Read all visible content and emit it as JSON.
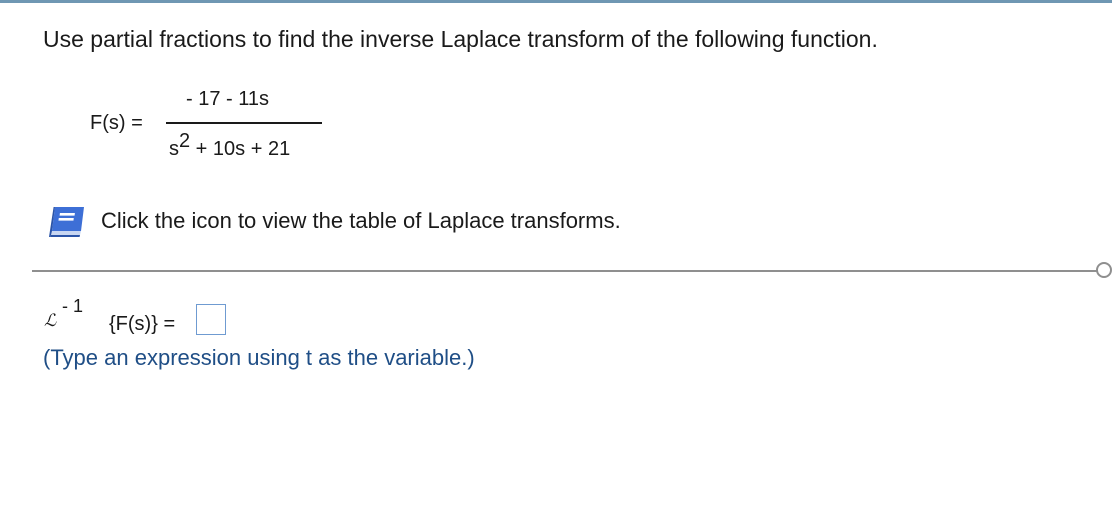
{
  "question": {
    "prompt": "Use partial fractions to find the inverse Laplace transform of the following function."
  },
  "function": {
    "label": "F(s) =",
    "numerator": "- 17 - 11s",
    "denominator_base": "s",
    "denominator_exponent": "2",
    "denominator_rest": " + 10s + 21"
  },
  "table_link": {
    "icon": "book-icon",
    "text": "Click the icon to view the table of Laplace transforms."
  },
  "answer": {
    "operator_symbol": "ℒ",
    "inverse_exponent": "- 1",
    "lhs": "{F(s)} =",
    "value": "",
    "hint": "(Type an expression using t as the variable.)"
  },
  "colors": {
    "top_rule": "#6f97b3",
    "hint_text": "#1f4e86",
    "answer_box_border": "#6f9bd1",
    "icon_blue": "#3d6fd6"
  }
}
